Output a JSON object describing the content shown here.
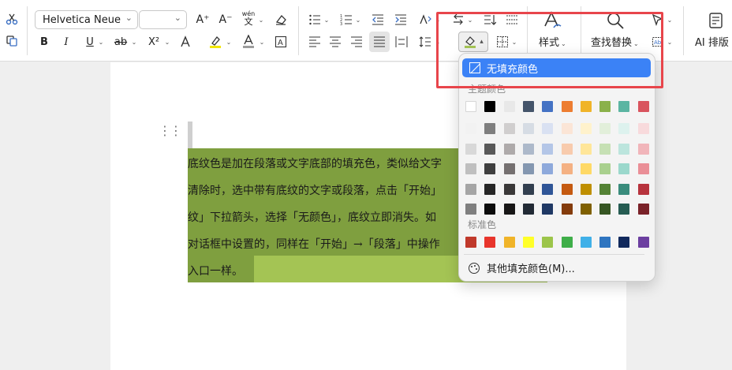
{
  "toolbar": {
    "font_name": "Helvetica Neue",
    "font_size": "",
    "bold": "B",
    "italic": "I",
    "underline": "U",
    "strike": "ab",
    "superscript": "X²",
    "grow_font": "A⁺",
    "shrink_font": "A⁻",
    "phonetic_top": "wén",
    "phonetic_bottom": "文",
    "style_label": "样式",
    "find_replace_label": "查找替换",
    "ai_label": "AI 排版"
  },
  "document": {
    "lines": [
      "底纹色是加在段落或文字底部的填充色，类似给文字",
      "清除时，选中带有底纹的文字或段落，点击「开始」",
      "纹」下拉箭头，选择「无颜色」，底纹立即消失。如",
      "对话框中设置的，同样在「开始」→「段落」中操作",
      "入口一样。"
    ]
  },
  "popup": {
    "no_fill": "无填充颜色",
    "theme_label": "主题颜色",
    "standard_label": "标准色",
    "more_colors": "其他填充颜色(M)...",
    "theme_top": [
      "#ffffff",
      "#000000",
      "#e8e8e8",
      "#44546a",
      "#4472c4",
      "#ed7d31",
      "#f0b429",
      "#8ab14a",
      "#5bb5a2",
      "#d9545e"
    ],
    "theme_tints": [
      [
        "#f2f2f2",
        "#7f7f7f",
        "#d0cece",
        "#d6dce4",
        "#d9e1f2",
        "#fbe5d6",
        "#fff2cc",
        "#e2efda",
        "#ddf2ee",
        "#f8dadc"
      ],
      [
        "#d8d8d8",
        "#595959",
        "#aeaaaa",
        "#adb9ca",
        "#b4c6e7",
        "#f8cbad",
        "#ffe699",
        "#c6e0b4",
        "#bce5dd",
        "#f1b5ba"
      ],
      [
        "#bfbfbf",
        "#3f3f3f",
        "#757070",
        "#8497b0",
        "#8ea9db",
        "#f4b183",
        "#ffd966",
        "#a9d08e",
        "#9bd8cc",
        "#ea8f97"
      ],
      [
        "#a5a5a5",
        "#262626",
        "#3a3838",
        "#323f4f",
        "#2f5597",
        "#c55a11",
        "#bf8f00",
        "#548235",
        "#3a8c7c",
        "#b7333d"
      ],
      [
        "#7f7f7f",
        "#0c0c0c",
        "#171616",
        "#222a35",
        "#1f3864",
        "#843c0c",
        "#7f6000",
        "#375623",
        "#265c52",
        "#7a2229"
      ]
    ],
    "standard": [
      "#c0392b",
      "#e8352c",
      "#f0b429",
      "#ffff29",
      "#9cc54a",
      "#3fae49",
      "#40b0e8",
      "#2f75c0",
      "#11295c",
      "#6c3fa0"
    ]
  }
}
